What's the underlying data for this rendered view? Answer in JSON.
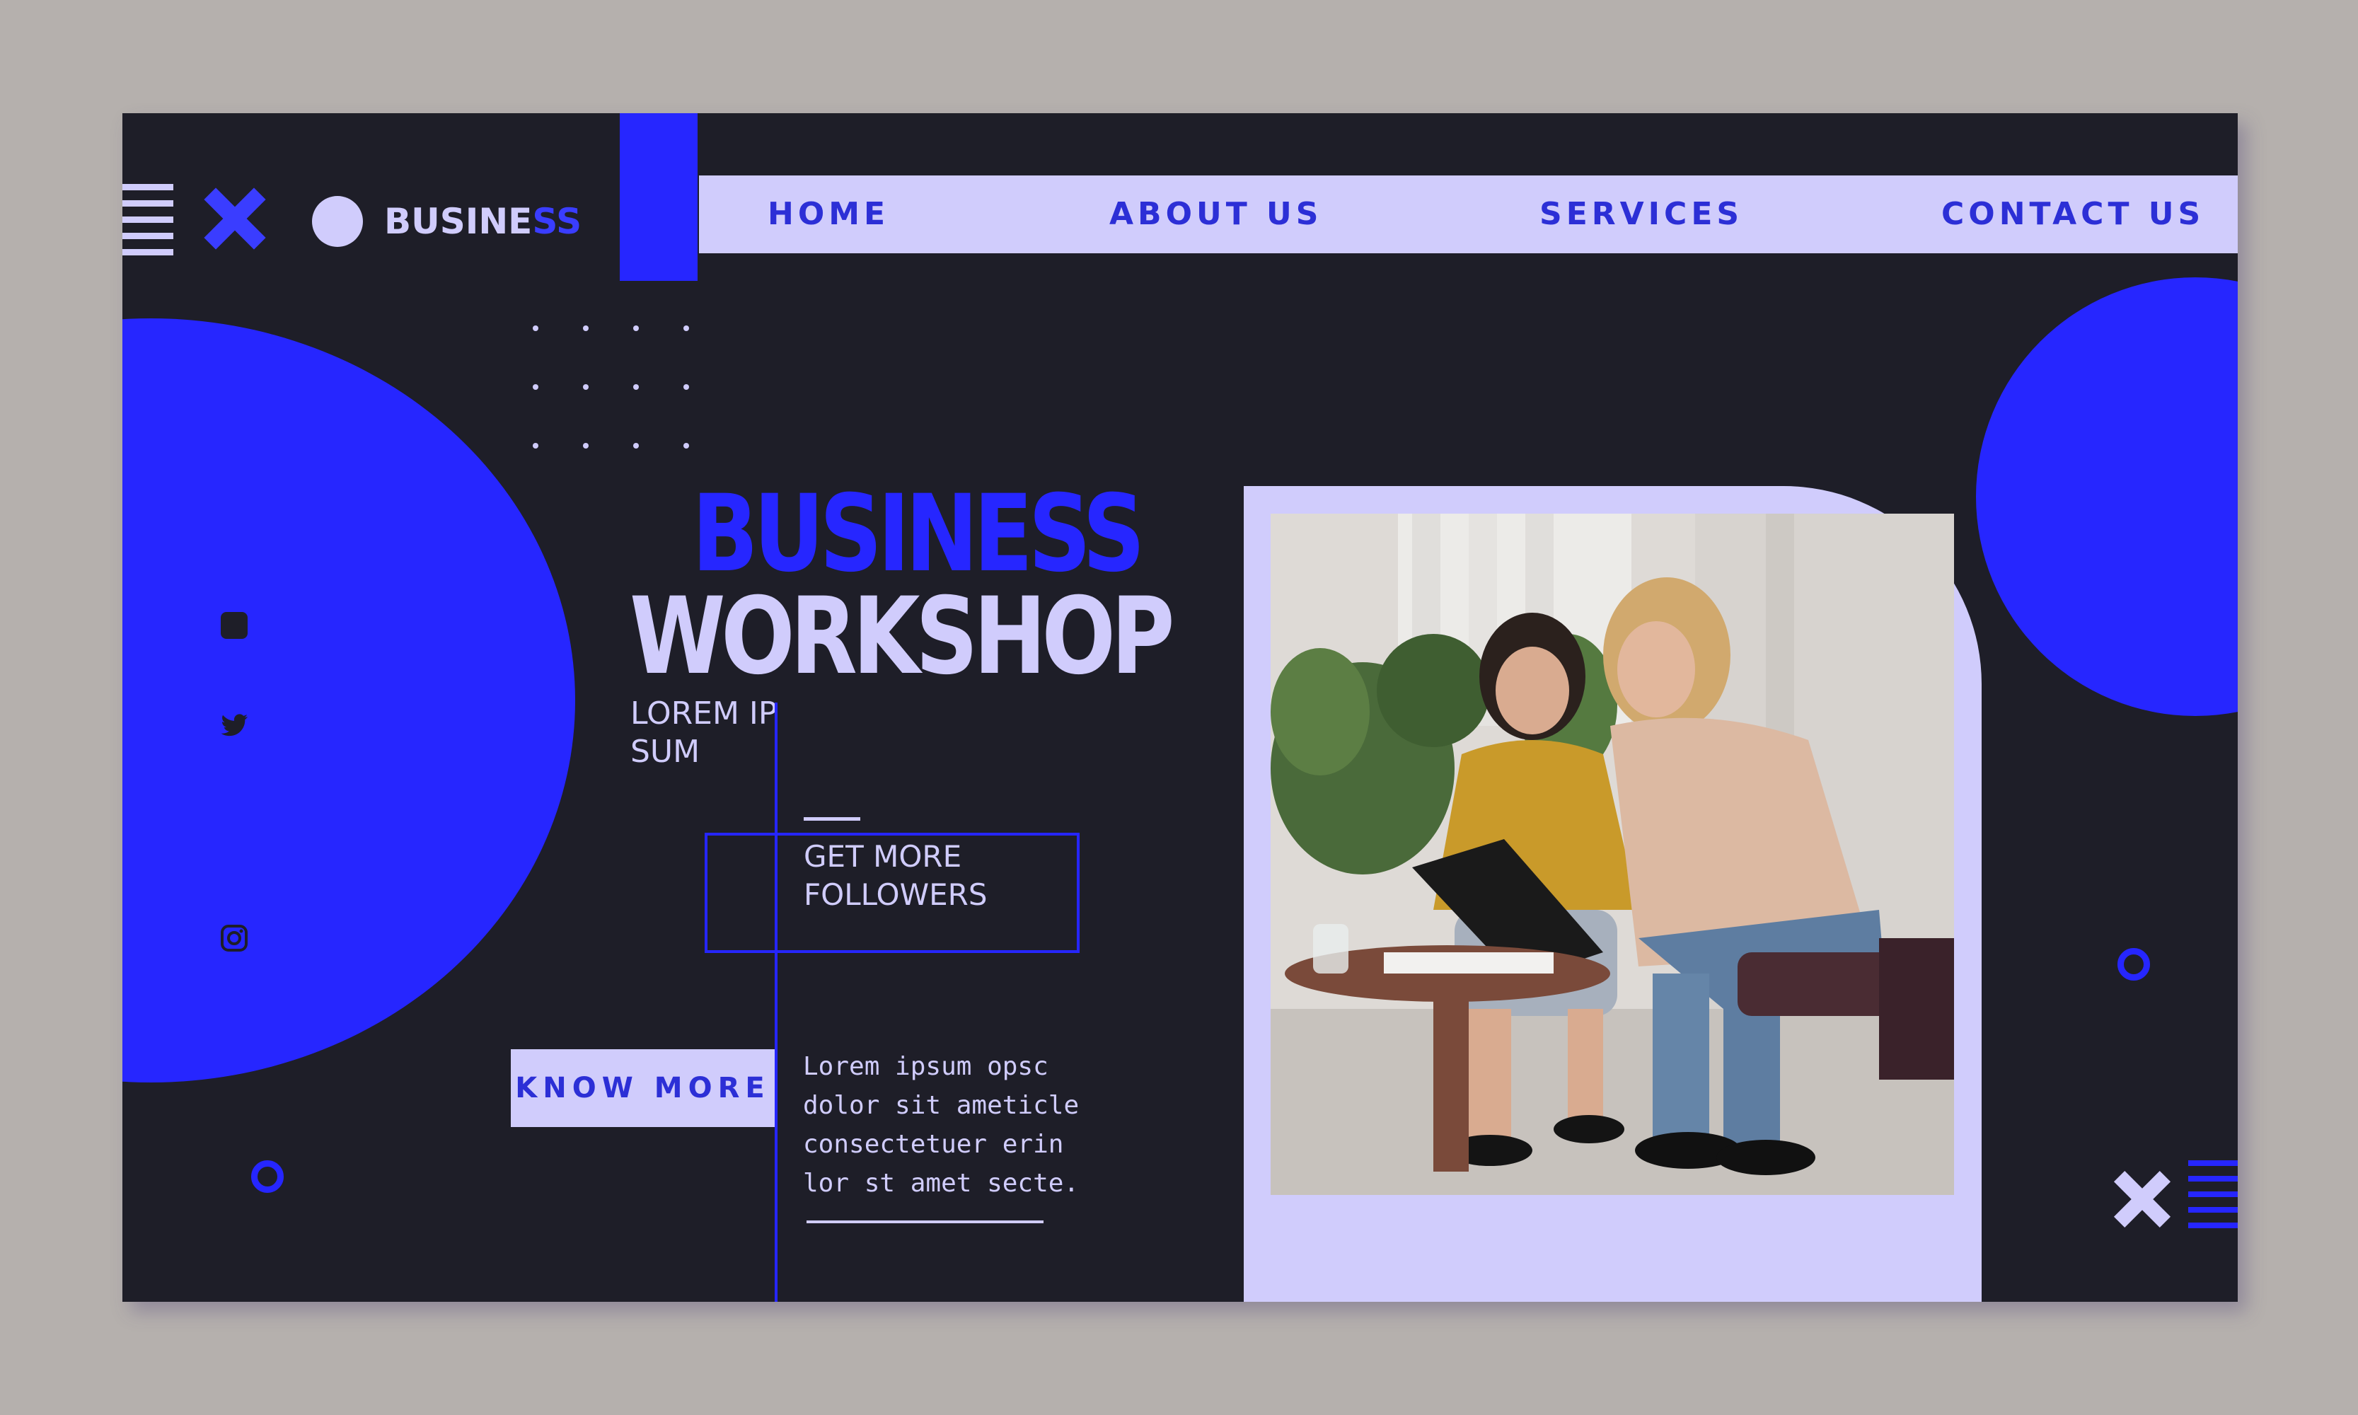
{
  "logo": {
    "text_main": "BUSINE",
    "text_accent": "SS"
  },
  "nav": {
    "items": [
      {
        "label": "HOME"
      },
      {
        "label": "ABOUT US"
      },
      {
        "label": "SERVICES"
      },
      {
        "label": "CONTACT US"
      }
    ]
  },
  "hero": {
    "title_line1": "BUSINESS",
    "title_line2": "WORKSHOP",
    "subtitle": "LOREM IP SUM",
    "followers_text": "GET MORE FOLLOWERS",
    "cta_label": "KNOW MORE",
    "body_text": "Lorem ipsum opsc\ndolor sit ameticle\nconsectetuer erin\nlor st amet secte."
  },
  "social": [
    "facebook-icon",
    "twitter-icon",
    "instagram-icon"
  ],
  "colors": {
    "background": "#b5b0ad",
    "card": "#1e1e28",
    "accent_blue": "#2626ff",
    "lavender": "#d0ccfc",
    "nav_text": "#2c2fd6"
  }
}
